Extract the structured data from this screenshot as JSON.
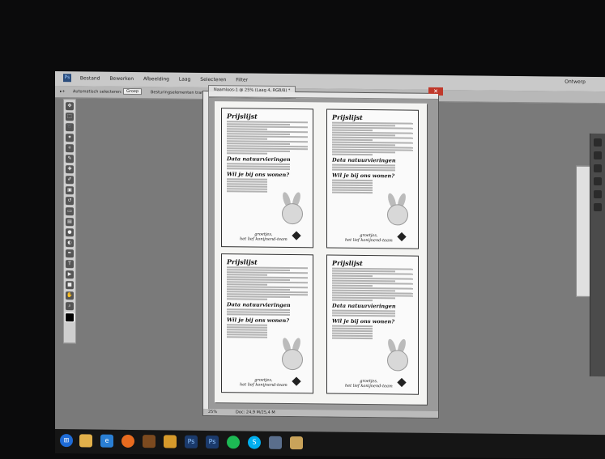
{
  "menubar": {
    "items": [
      "Bestand",
      "Bewerken",
      "Afbeelding",
      "Laag",
      "Selecteren",
      "Filter"
    ]
  },
  "optbar": {
    "auto_select": "Automatisch selecteren:",
    "auto_select_value": "Groep",
    "transform_controls": "Besturingselementen transformatie tonen"
  },
  "workspace": {
    "label": "Ontwerp"
  },
  "document": {
    "tab_title": "Naamloos-1 @ 25% (Laag 4, RGB/8) *",
    "zoom": "25%",
    "doc_info": "Doc: 24,9 M/25,4 M"
  },
  "card": {
    "title": "Prijslijst",
    "heading_dates": "Data natuurvieringen",
    "heading_house": "Wil je bij ons wonen?",
    "signoff": "groetjes,",
    "team": "het lief konijnend-team"
  },
  "taskbar": {
    "apps": [
      "start",
      "explorer",
      "ie",
      "firefox",
      "ps-other",
      "folder",
      "photoshop",
      "photoshop2",
      "spotify",
      "skype",
      "media",
      "files"
    ]
  }
}
